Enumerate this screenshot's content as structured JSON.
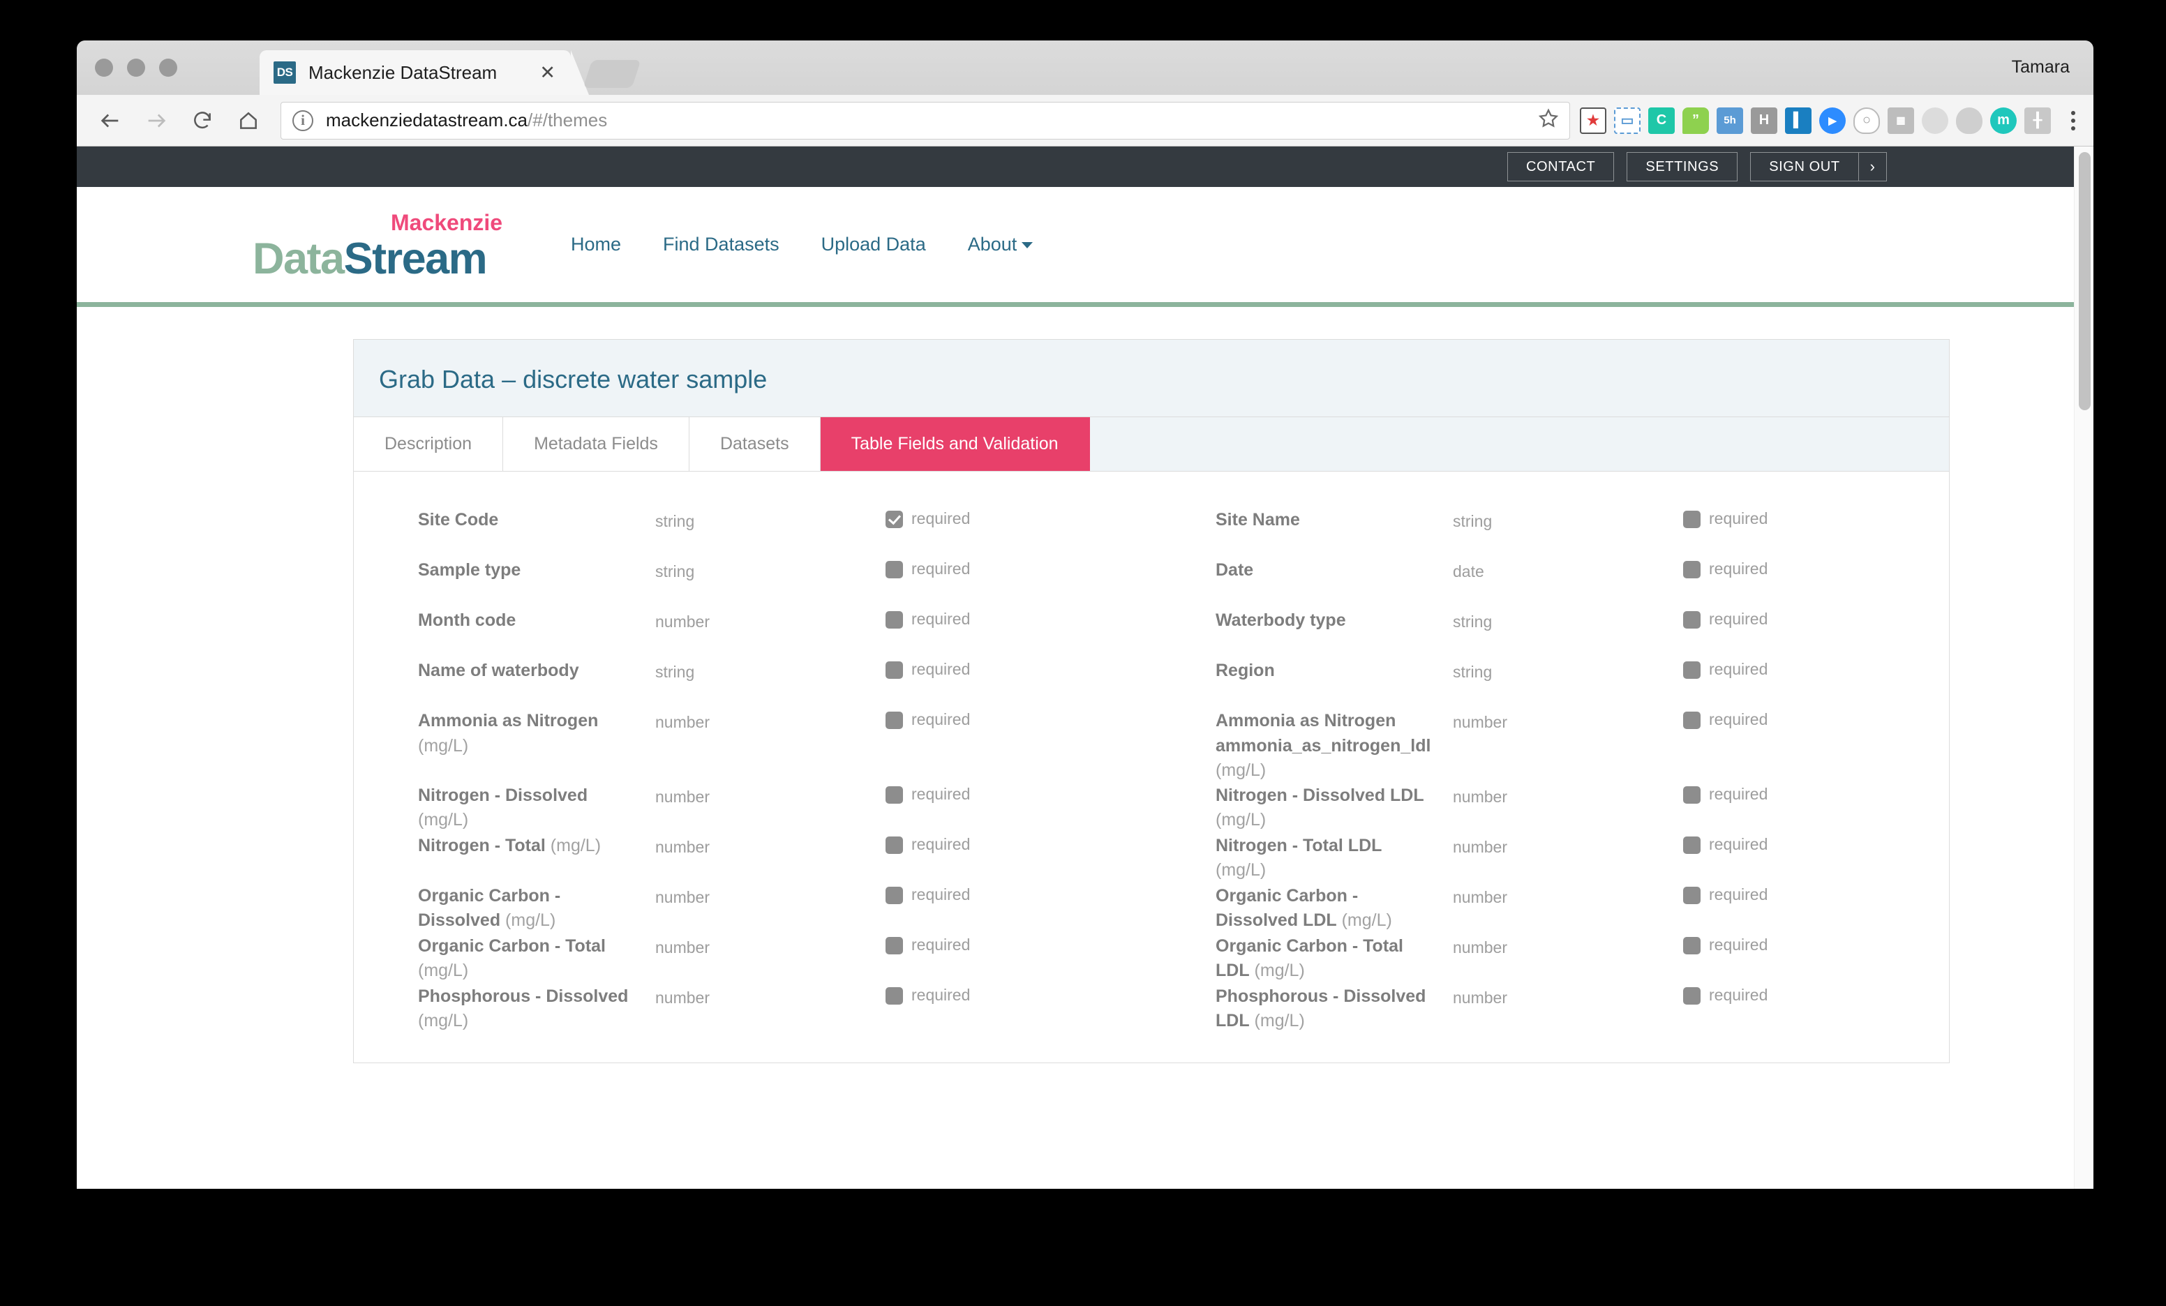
{
  "window": {
    "user_label": "Tamara",
    "tab": {
      "favicon_text": "DS",
      "title": "Mackenzie DataStream",
      "close_icon": "close-icon"
    },
    "new_tab_icon": "new-tab-icon"
  },
  "toolbar": {
    "back_icon": "back-arrow-icon",
    "forward_icon": "forward-arrow-icon",
    "reload_icon": "reload-icon",
    "home_icon": "home-icon",
    "security_icon": "info-circle-icon",
    "url_main": "mackenziedatastream.ca",
    "url_path": "/#/themes",
    "bookmark_icon": "star-icon",
    "menu_icon": "kebab-menu-icon",
    "extensions": [
      {
        "name": "calendar-star-extension",
        "glyph": "★",
        "bg": "#ffffff",
        "fg": "#e03a3a",
        "border": "#4a4a4a"
      },
      {
        "name": "screenshot-extension",
        "glyph": "▭",
        "bg": "#ffffff",
        "fg": "#5b9bd5",
        "border": "#5b9bd5"
      },
      {
        "name": "grammarly-extension",
        "glyph": "C",
        "bg": "#1fc7a8",
        "fg": "#ffffff",
        "border": "#1fc7a8"
      },
      {
        "name": "quote-bubble-extension",
        "glyph": "”",
        "bg": "#8ed14f",
        "fg": "#ffffff",
        "border": "#8ed14f"
      },
      {
        "name": "timer-5h-extension",
        "glyph": "5h",
        "bg": "#5b9bd5",
        "fg": "#ffffff",
        "border": "#5b9bd5"
      },
      {
        "name": "hootsuite-extension",
        "glyph": "H",
        "bg": "#9a9a9a",
        "fg": "#ffffff",
        "border": "#9a9a9a"
      },
      {
        "name": "trello-extension",
        "glyph": "▌",
        "bg": "#1a7fc1",
        "fg": "#ffffff",
        "border": "#1a7fc1"
      },
      {
        "name": "zoom-extension",
        "glyph": "▶",
        "bg": "#2d8cff",
        "fg": "#ffffff",
        "border": "#2d8cff"
      },
      {
        "name": "ghost-extension",
        "glyph": "○",
        "bg": "#ffffff",
        "fg": "#9a9a9a",
        "border": "#b5b5b5"
      },
      {
        "name": "map-extension",
        "glyph": "▦",
        "bg": "#bdbdbd",
        "fg": "#ffffff",
        "border": "#bdbdbd"
      },
      {
        "name": "oval-grey-extension",
        "glyph": "",
        "bg": "#dcdcdc",
        "fg": "#ffffff",
        "border": "#dcdcdc"
      },
      {
        "name": "pin-extension",
        "glyph": "●",
        "bg": "#cfcfcf",
        "fg": "#ffffff",
        "border": "#cfcfcf"
      },
      {
        "name": "mailchimp-extension",
        "glyph": "m",
        "bg": "#1fc7bc",
        "fg": "#ffffff",
        "border": "#1fc7bc"
      },
      {
        "name": "hubspot-extension",
        "glyph": "⑂",
        "bg": "#c8c8c8",
        "fg": "#ffffff",
        "border": "#c8c8c8"
      }
    ]
  },
  "topbar": {
    "contact_label": "CONTACT",
    "settings_label": "SETTINGS",
    "signout_label": "SIGN OUT",
    "signout_caret": "›"
  },
  "site": {
    "logo": {
      "data": "Data",
      "stream": "Stream",
      "mackenzie": "Mackenzie"
    },
    "nav": [
      {
        "label": "Home"
      },
      {
        "label": "Find Datasets"
      },
      {
        "label": "Upload Data"
      },
      {
        "label": "About"
      }
    ]
  },
  "panel": {
    "title": "Grab Data – discrete water sample",
    "tabs": [
      {
        "label": "Description",
        "active": false
      },
      {
        "label": "Metadata Fields",
        "active": false
      },
      {
        "label": "Datasets",
        "active": false
      },
      {
        "label": "Table Fields and Validation",
        "active": true
      }
    ],
    "required_label": "required",
    "fields": [
      {
        "name": "Site Code",
        "unit": "",
        "type": "string",
        "required_checked": true
      },
      {
        "name": "Site Name",
        "unit": "",
        "type": "string",
        "required_checked": false
      },
      {
        "name": "Sample type",
        "unit": "",
        "type": "string",
        "required_checked": false
      },
      {
        "name": "Date",
        "unit": "",
        "type": "date",
        "required_checked": false
      },
      {
        "name": "Month code",
        "unit": "",
        "type": "number",
        "required_checked": false
      },
      {
        "name": "Waterbody type",
        "unit": "",
        "type": "string",
        "required_checked": false
      },
      {
        "name": "Name of waterbody",
        "unit": "",
        "type": "string",
        "required_checked": false
      },
      {
        "name": "Region",
        "unit": "",
        "type": "string",
        "required_checked": false
      },
      {
        "name": "Ammonia as Nitrogen",
        "unit": "(mg/L)",
        "type": "number",
        "required_checked": false
      },
      {
        "name": "Ammonia as Nitrogen ammonia_as_nitrogen_ldl",
        "unit": "(mg/L)",
        "type": "number",
        "required_checked": false
      },
      {
        "name": "Nitrogen - Dissolved",
        "unit": "(mg/L)",
        "type": "number",
        "required_checked": false
      },
      {
        "name": "Nitrogen - Dissolved LDL",
        "unit": "(mg/L)",
        "type": "number",
        "required_checked": false
      },
      {
        "name": "Nitrogen - Total",
        "unit": "(mg/L)",
        "type": "number",
        "required_checked": false
      },
      {
        "name": "Nitrogen - Total LDL",
        "unit": "(mg/L)",
        "type": "number",
        "required_checked": false
      },
      {
        "name": "Organic Carbon - Dissolved",
        "unit": "(mg/L)",
        "type": "number",
        "required_checked": false
      },
      {
        "name": "Organic Carbon - Dissolved LDL",
        "unit": "(mg/L)",
        "type": "number",
        "required_checked": false
      },
      {
        "name": "Organic Carbon - Total",
        "unit": "(mg/L)",
        "type": "number",
        "required_checked": false
      },
      {
        "name": "Organic Carbon - Total LDL",
        "unit": "(mg/L)",
        "type": "number",
        "required_checked": false
      },
      {
        "name": "Phosphorous - Dissolved",
        "unit": "(mg/L)",
        "type": "number",
        "required_checked": false
      },
      {
        "name": "Phosphorous - Dissolved LDL",
        "unit": "(mg/L)",
        "type": "number",
        "required_checked": false
      }
    ]
  },
  "colors": {
    "accent_pink": "#e8406a",
    "brand_teal": "#2b6a86",
    "brand_green": "#8cb49c",
    "logo_pink": "#ef4a7b",
    "topbar_dark": "#343a40"
  }
}
